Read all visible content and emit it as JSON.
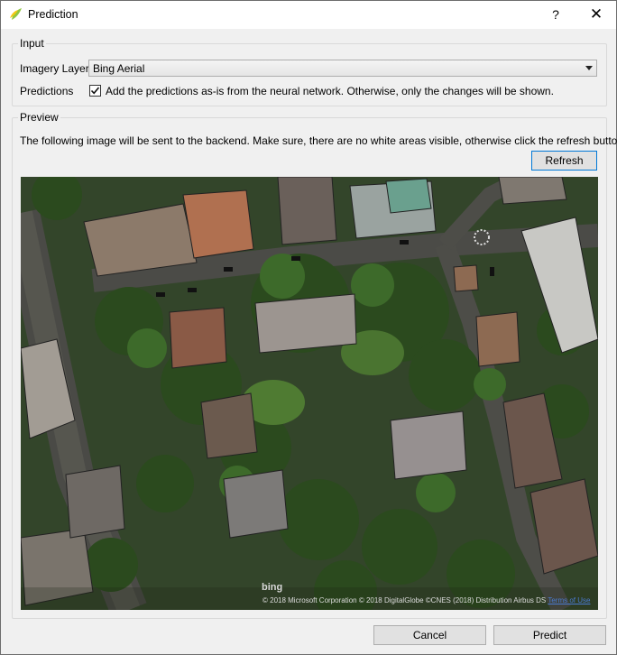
{
  "window": {
    "title": "Prediction",
    "help_label": "?",
    "close_label": "✕"
  },
  "input_group": {
    "legend": "Input",
    "imagery_label": "Imagery Layer",
    "imagery_value": "Bing Aerial",
    "predictions_label": "Predictions",
    "predictions_checked": true,
    "predictions_text": "Add the predictions as-is from the neural network. Otherwise, only the changes will be shown."
  },
  "preview_group": {
    "legend": "Preview",
    "instruction": "The following image will be sent to the backend. Make sure, there are no white areas visible, otherwise click the refresh button.",
    "refresh_label": "Refresh",
    "bing_logo": "bing",
    "attribution": "© 2018 Microsoft Corporation © 2018 DigitalGlobe ©CNES (2018) Distribution Airbus DS",
    "terms_link": "Terms of Use"
  },
  "footer": {
    "cancel_label": "Cancel",
    "predict_label": "Predict"
  },
  "colors": {
    "accent": "#0078d7",
    "terms_link": "#4a7bd1"
  }
}
